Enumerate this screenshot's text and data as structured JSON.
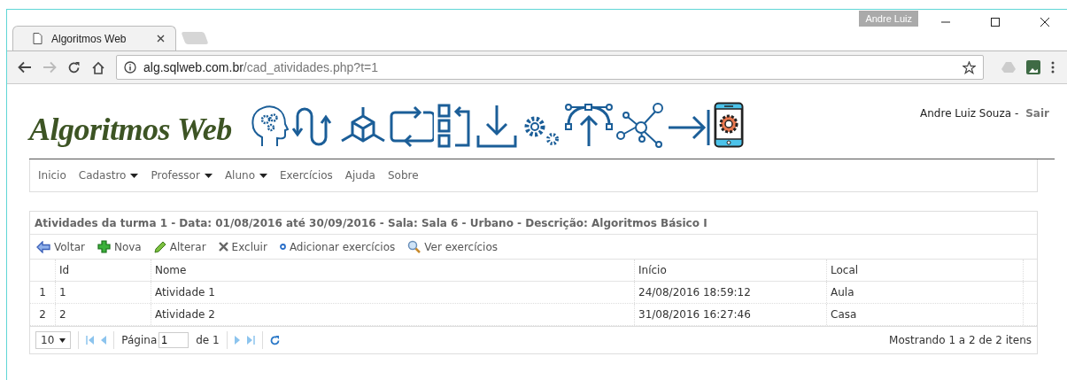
{
  "browser": {
    "tabs": [
      {
        "title": "Algoritmos Web",
        "selected": true
      }
    ],
    "profile": "Andre Luiz",
    "url": {
      "host": "alg.sqlweb.com.br",
      "path": "/cad_atividades.php?t=1"
    }
  },
  "header": {
    "logo": "Algoritmos Web",
    "user": "Andre Luiz Souza -",
    "logout": "Sair"
  },
  "menu": [
    {
      "label": "Inicio",
      "dropdown": false
    },
    {
      "label": "Cadastro",
      "dropdown": true
    },
    {
      "label": "Professor",
      "dropdown": true
    },
    {
      "label": "Aluno",
      "dropdown": true
    },
    {
      "label": "Exercícios",
      "dropdown": false
    },
    {
      "label": "Ajuda",
      "dropdown": false
    },
    {
      "label": "Sobre",
      "dropdown": false
    }
  ],
  "panel": {
    "title": "Atividades da turma 1 - Data: 01/08/2016 até 30/09/2016 - Sala: Sala 6 - Urbano - Descrição: Algoritmos Básico I",
    "toolbar": [
      {
        "label": "Voltar",
        "kind": "back"
      },
      {
        "label": "Nova",
        "kind": "add"
      },
      {
        "label": "Alterar",
        "kind": "edit"
      },
      {
        "label": "Excluir",
        "kind": "delete"
      },
      {
        "label": "Adicionar exercícios",
        "kind": "dot"
      },
      {
        "label": "Ver exercícios",
        "kind": "search"
      }
    ],
    "columns": [
      "Id",
      "Nome",
      "Início",
      "Local"
    ],
    "rows": [
      {
        "number": "1",
        "cells": [
          "1",
          "Atividade 1",
          "24/08/2016 18:59:12",
          "Aula"
        ]
      },
      {
        "number": "2",
        "cells": [
          "2",
          "Atividade 2",
          "31/08/2016 16:27:46",
          "Casa"
        ]
      }
    ],
    "pager": {
      "page_size": "10",
      "page_label": "Página",
      "page": "1",
      "page_total": "de 1",
      "summary": "Mostrando 1 a 2 de 2 itens"
    }
  }
}
